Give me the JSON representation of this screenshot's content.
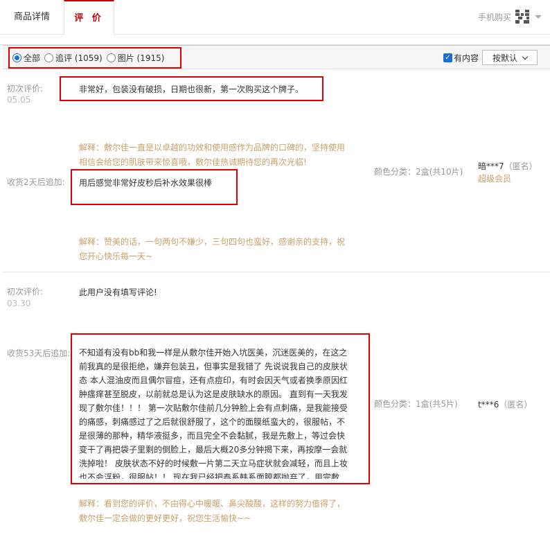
{
  "tabs": {
    "details": "商品详情",
    "reviews": "评 价",
    "mobile_buy": "手机购买"
  },
  "filters": {
    "all": "全部",
    "followup": "追评 (1059)",
    "pictures": "图片 (1915)",
    "has_content": "有内容",
    "sort": "按默认"
  },
  "reviews": [
    {
      "initial_label": "初次评价:",
      "initial_date": "05.05",
      "initial_text": "非常好，包装没有破损，日期也很新，第一次购买这个牌子。",
      "initial_reply": "解释：敷尔佳一直是以卓越的功效和使用感作为品牌的口碑的，坚持使用相信会给您的肌肤带来惊喜哦，敷尔佳热诚期待您的再次光临!",
      "followup_label": "收货2天后追加:",
      "followup_text": "用后感觉非常好皮秒后补水效果很棒",
      "followup_reply": "解释：赞美的话，一句两句不嫌少，三句四句也蛮好，感谢亲的支持，祝您开心快乐每一天~",
      "sku_label": "颜色分类：",
      "sku_value": "2盒(共10片)",
      "user": "暗***7",
      "anon": "（匿名）",
      "vip": "超级会员"
    },
    {
      "initial_label": "初次评价:",
      "initial_date": "03.30",
      "initial_text": "此用户没有填写评论!",
      "followup_label": "收货53天后追加:",
      "followup_text": "不知道有没有bb和我一样是从敷尔佳开始入坑医美，沉迷医美的，在这之前我真的是很拒绝，嫌弃包装丑，但事实是我错了 先说说我自己的皮肤状态 本人混油皮而且偶尔冒痘，还有点痘印，有时会因天气或者换季原因红肿瘙痒甚至脱皮，以前就总是认为这是皮肤缺水的原因。 直到有一天我发现了敷尔佳！！！ 第一次贴敷尔佳前几分钟脸上会有点刺痛，是我能接受的痛感，刺痛感过了之后就很舒服了，这个的面膜纸蛮大的，很服帖，不是很薄的那种，精华液挺多，而且完全不会黏腻，我是先敷上，等过会快变干了再把袋子里剩的倒脸上，最后大概20多分钟揭下来，再按摩一会就洗掉啦！ 皮肤状态不好的时候敷一片第二天立马症状就会减轻，而且上妆也不会浮粉，很服帖！！ 现在我已经把泰系韩系面膜都抛弃了，用完敷",
      "followup_reply": "解释：看到您的评价，不由得心中暖暖、鼻尖酸酸，这样的努力值得了，敷尔佳一定会做的更好更好，祝您生活愉快~~",
      "sku_label": "颜色分类：",
      "sku_value": "1盒(共5片)",
      "user": "t***6",
      "anon": "（匿名）"
    }
  ]
}
